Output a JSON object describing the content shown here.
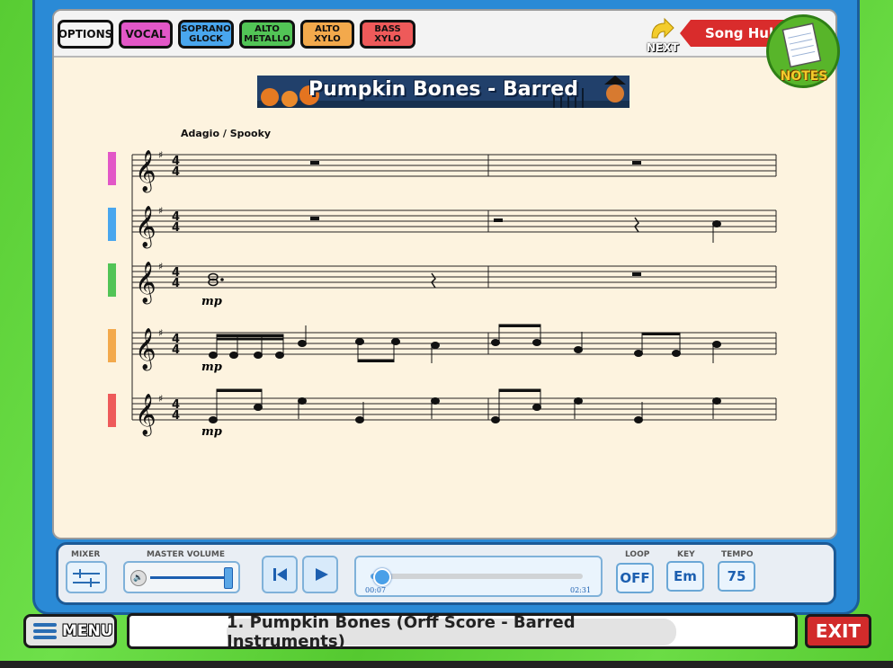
{
  "toolbar": {
    "buttons": [
      {
        "label": "OPTIONS",
        "color": "#f4f4f4"
      },
      {
        "label": "VOCAL",
        "color": "#e257c7"
      },
      {
        "label": "SOPRANO\nGLOCK",
        "color": "#49a6ee"
      },
      {
        "label": "ALTO\nMETALLO",
        "color": "#52c456"
      },
      {
        "label": "ALTO\nXYLO",
        "color": "#f3a94c"
      },
      {
        "label": "BASS\nXYLO",
        "color": "#ee5a5a"
      }
    ],
    "next_label": "NEXT",
    "song_hub_label": "Song Hub",
    "notes_label": "NOTES"
  },
  "score": {
    "title": "Pumpkin Bones - Barred",
    "tempo_marking": "Adagio / Spooky",
    "part_colors": [
      "#e257c7",
      "#49a6ee",
      "#52c456",
      "#f3a94c",
      "#ee5a5a"
    ],
    "dynamics": [
      "mp",
      "mp",
      "mp"
    ],
    "time_signature": "4/4",
    "key_signature": "sharp"
  },
  "transport": {
    "mixer_label": "MIXER",
    "master_volume_label": "MASTER VOLUME",
    "master_volume_level": 1.0,
    "time_elapsed": "00:07",
    "time_total": "02:31",
    "progress": 0.045,
    "loop_label": "LOOP",
    "loop_value": "OFF",
    "key_label": "KEY",
    "key_value": "Em",
    "tempo_label": "TEMPO",
    "tempo_value": "75"
  },
  "footer": {
    "menu_label": "MENU",
    "song_title": "1. Pumpkin Bones (Orff Score - Barred Instruments)",
    "exit_label": "EXIT"
  }
}
